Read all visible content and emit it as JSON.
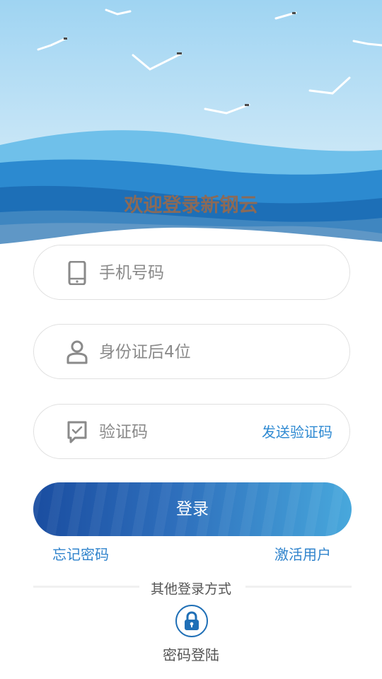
{
  "header": {
    "welcome_text": "欢迎登录新钢云"
  },
  "form": {
    "phone": {
      "placeholder": "手机号码",
      "icon": "phone-icon"
    },
    "id": {
      "placeholder": "身份证后4位",
      "icon": "user-icon"
    },
    "code": {
      "placeholder": "验证码",
      "icon": "verify-icon",
      "send_label": "发送验证码"
    }
  },
  "actions": {
    "login_label": "登录",
    "forgot_label": "忘记密码",
    "activate_label": "激活用户"
  },
  "other": {
    "title": "其他登录方式",
    "password_login_label": "密码登陆",
    "icon": "lock-icon"
  },
  "colors": {
    "accent": "#2f8ad2",
    "button_start": "#1a4da0",
    "button_end": "#48a8dc"
  }
}
